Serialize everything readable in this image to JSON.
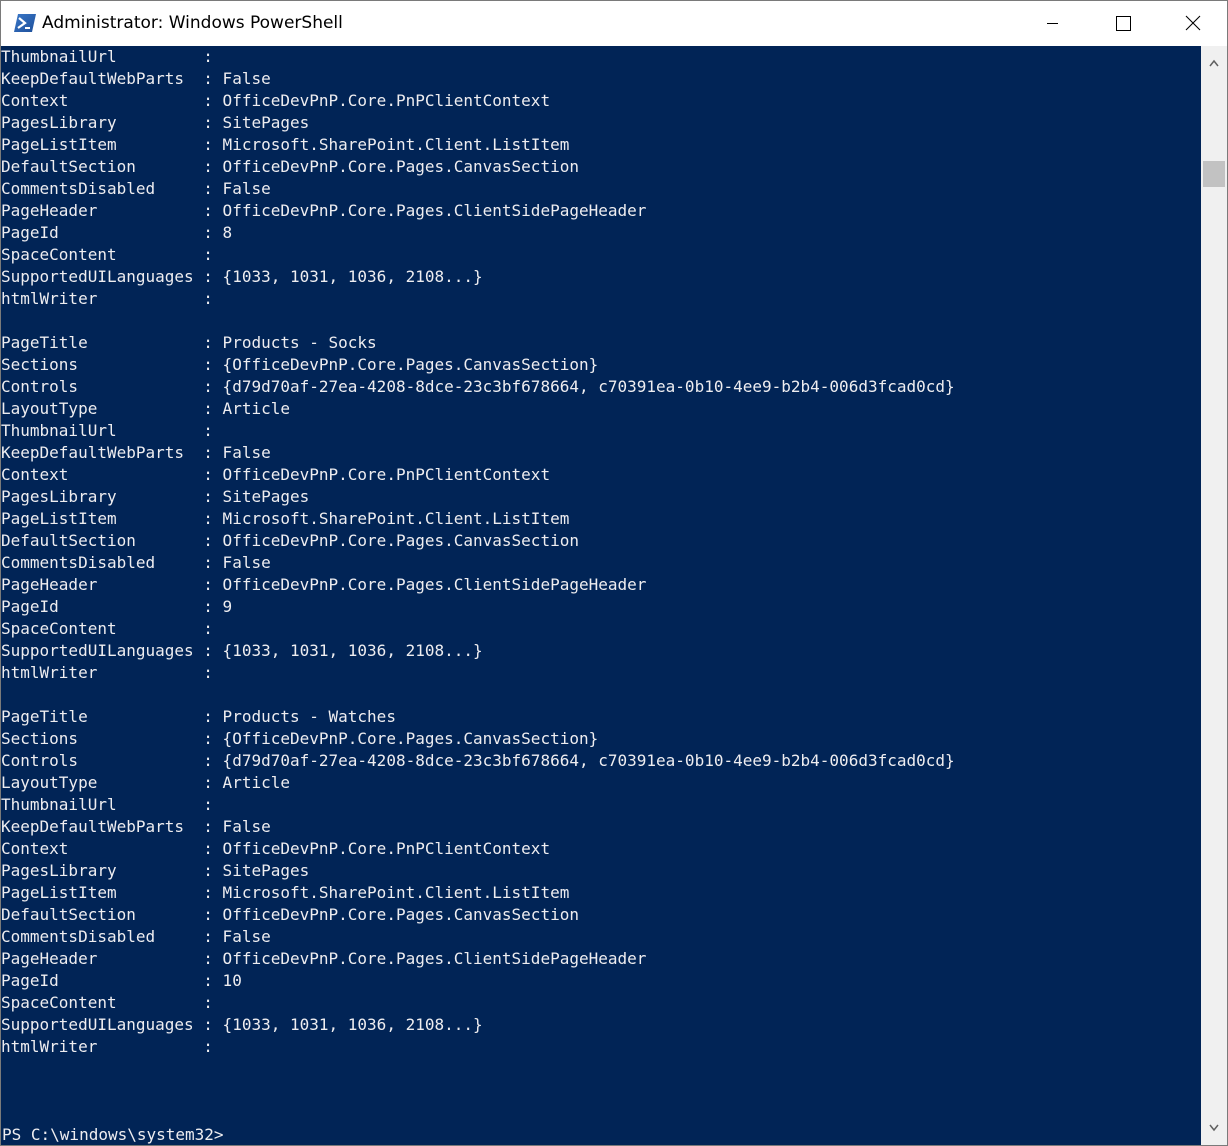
{
  "window": {
    "title": "Administrator: Windows PowerShell"
  },
  "console": {
    "lines": [
      [
        "ThumbnailUrl",
        ""
      ],
      [
        "KeepDefaultWebParts",
        "False"
      ],
      [
        "Context",
        "OfficeDevPnP.Core.PnPClientContext"
      ],
      [
        "PagesLibrary",
        "SitePages"
      ],
      [
        "PageListItem",
        "Microsoft.SharePoint.Client.ListItem"
      ],
      [
        "DefaultSection",
        "OfficeDevPnP.Core.Pages.CanvasSection"
      ],
      [
        "CommentsDisabled",
        "False"
      ],
      [
        "PageHeader",
        "OfficeDevPnP.Core.Pages.ClientSidePageHeader"
      ],
      [
        "PageId",
        "8"
      ],
      [
        "SpaceContent",
        ""
      ],
      [
        "SupportedUILanguages",
        "{1033, 1031, 1036, 2108...}"
      ],
      [
        "htmlWriter",
        ""
      ],
      null,
      [
        "PageTitle",
        "Products - Socks"
      ],
      [
        "Sections",
        "{OfficeDevPnP.Core.Pages.CanvasSection}"
      ],
      [
        "Controls",
        "{d79d70af-27ea-4208-8dce-23c3bf678664, c70391ea-0b10-4ee9-b2b4-006d3fcad0cd}"
      ],
      [
        "LayoutType",
        "Article"
      ],
      [
        "ThumbnailUrl",
        ""
      ],
      [
        "KeepDefaultWebParts",
        "False"
      ],
      [
        "Context",
        "OfficeDevPnP.Core.PnPClientContext"
      ],
      [
        "PagesLibrary",
        "SitePages"
      ],
      [
        "PageListItem",
        "Microsoft.SharePoint.Client.ListItem"
      ],
      [
        "DefaultSection",
        "OfficeDevPnP.Core.Pages.CanvasSection"
      ],
      [
        "CommentsDisabled",
        "False"
      ],
      [
        "PageHeader",
        "OfficeDevPnP.Core.Pages.ClientSidePageHeader"
      ],
      [
        "PageId",
        "9"
      ],
      [
        "SpaceContent",
        ""
      ],
      [
        "SupportedUILanguages",
        "{1033, 1031, 1036, 2108...}"
      ],
      [
        "htmlWriter",
        ""
      ],
      null,
      [
        "PageTitle",
        "Products - Watches"
      ],
      [
        "Sections",
        "{OfficeDevPnP.Core.Pages.CanvasSection}"
      ],
      [
        "Controls",
        "{d79d70af-27ea-4208-8dce-23c3bf678664, c70391ea-0b10-4ee9-b2b4-006d3fcad0cd}"
      ],
      [
        "LayoutType",
        "Article"
      ],
      [
        "ThumbnailUrl",
        ""
      ],
      [
        "KeepDefaultWebParts",
        "False"
      ],
      [
        "Context",
        "OfficeDevPnP.Core.PnPClientContext"
      ],
      [
        "PagesLibrary",
        "SitePages"
      ],
      [
        "PageListItem",
        "Microsoft.SharePoint.Client.ListItem"
      ],
      [
        "DefaultSection",
        "OfficeDevPnP.Core.Pages.CanvasSection"
      ],
      [
        "CommentsDisabled",
        "False"
      ],
      [
        "PageHeader",
        "OfficeDevPnP.Core.Pages.ClientSidePageHeader"
      ],
      [
        "PageId",
        "10"
      ],
      [
        "SpaceContent",
        ""
      ],
      [
        "SupportedUILanguages",
        "{1033, 1031, 1036, 2108...}"
      ],
      [
        "htmlWriter",
        ""
      ]
    ],
    "prompt": "PS C:\\windows\\system32>"
  },
  "colors": {
    "console_bg": "#012456",
    "console_fg": "#eeedf0",
    "titlebar_bg": "#ffffff",
    "scrollbar_bg": "#f0f0f0",
    "scrollbar_thumb": "#c2c2c2"
  },
  "icons": {
    "app": "powershell-icon",
    "minimize": "minimize-icon",
    "maximize": "maximize-icon",
    "close": "close-icon",
    "scroll_up": "scroll-up-arrow-icon",
    "scroll_down": "scroll-down-arrow-icon"
  }
}
